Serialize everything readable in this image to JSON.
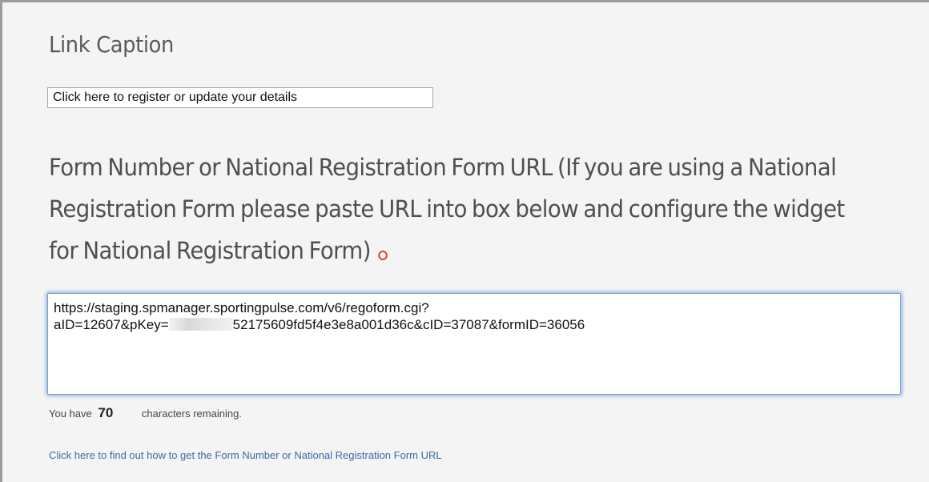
{
  "link_caption": {
    "title": "Link Caption",
    "input_value": "Click here to register or update your details"
  },
  "form_url": {
    "heading": "Form Number or National Registration Form URL (If you are using a National Registration Form please paste URL into box below and configure the widget for National Registration Form)",
    "url_line1": "https://staging.spmanager.sportingpulse.com/v6/regoform.cgi?",
    "url_line2_prefix": "aID=12607&pKey=",
    "url_line2_suffix": "52175609fd5f4e3e8a001d36c&cID=37087&formID=36056",
    "required_color": "#d83a2e"
  },
  "char_counter": {
    "prefix": "You have",
    "count": "70",
    "suffix": "characters remaining."
  },
  "help_link": {
    "label": "Click here to find out how to get the Form Number or National Registration Form URL",
    "color": "#3b6aa6"
  }
}
